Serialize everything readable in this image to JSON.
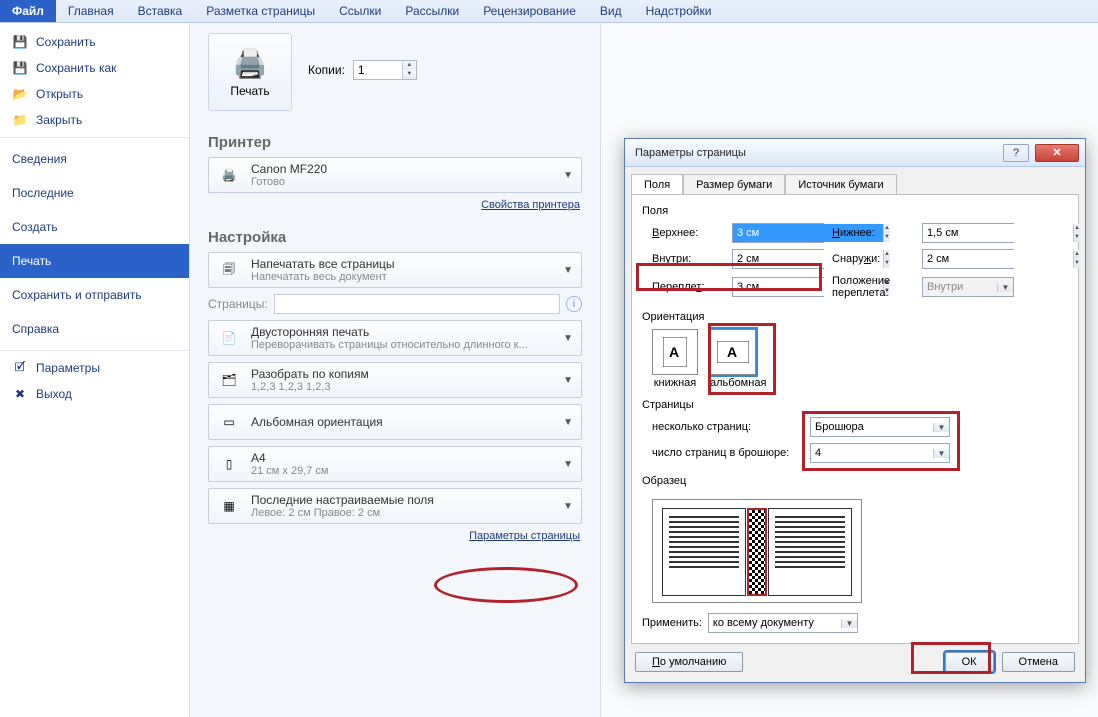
{
  "ribbon": {
    "tabs": [
      "Файл",
      "Главная",
      "Вставка",
      "Разметка страницы",
      "Ссылки",
      "Рассылки",
      "Рецензирование",
      "Вид",
      "Надстройки"
    ],
    "active_index": 0
  },
  "nav": {
    "save": "Сохранить",
    "save_as": "Сохранить как",
    "open": "Открыть",
    "close": "Закрыть",
    "info": "Сведения",
    "recent": "Последние",
    "new": "Создать",
    "print": "Печать",
    "share": "Сохранить и отправить",
    "help": "Справка",
    "options": "Параметры",
    "exit": "Выход"
  },
  "print": {
    "heading": "Печать",
    "button": "Печать",
    "copies_label": "Копии:",
    "copies_value": "1",
    "printer_heading": "Принтер",
    "printer_name": "Canon MF220",
    "printer_status": "Готово",
    "printer_props_link": "Свойства принтера",
    "settings_heading": "Настройка",
    "print_all_title": "Напечатать все страницы",
    "print_all_sub": "Напечатать весь документ",
    "pages_label": "Страницы:",
    "duplex_title": "Двусторонняя печать",
    "duplex_sub": "Переворачивать страницы относительно длинного к...",
    "collate_title": "Разобрать по копиям",
    "collate_sub": "1,2,3    1,2,3    1,2,3",
    "orient_title": "Альбомная ориентация",
    "paper_title": "A4",
    "paper_sub": "21 см x 29,7 см",
    "margins_title": "Последние настраиваемые поля",
    "margins_sub": "Левое: 2 см   Правое: 2 см",
    "page_setup_link": "Параметры страницы"
  },
  "dialog": {
    "title": "Параметры страницы",
    "tabs": [
      "Поля",
      "Размер бумаги",
      "Источник бумаги"
    ],
    "active_tab": 0,
    "fields_group": "Поля",
    "top_label": "Верхнее:",
    "top_value": "3 см",
    "bottom_label": "Нижнее:",
    "bottom_value": "1,5 см",
    "inside_label": "Внутри:",
    "inside_value": "2 см",
    "outside_label": "Снаружи:",
    "outside_value": "2 см",
    "gutter_label": "Переплет:",
    "gutter_value": "3 см",
    "gutter_pos_label": "Положение переплета:",
    "gutter_pos_value": "Внутри",
    "orient_group": "Ориентация",
    "orient_portrait": "книжная",
    "orient_landscape": "альбомная",
    "pages_group": "Страницы",
    "multi_label": "несколько страниц:",
    "multi_value": "Брошюра",
    "sheets_label": "число страниц в брошюре:",
    "sheets_value": "4",
    "preview_group": "Образец",
    "apply_label": "Применить:",
    "apply_value": "ко всему документу",
    "defaults_btn": "По умолчанию",
    "ok_btn": "ОК",
    "cancel_btn": "Отмена"
  }
}
